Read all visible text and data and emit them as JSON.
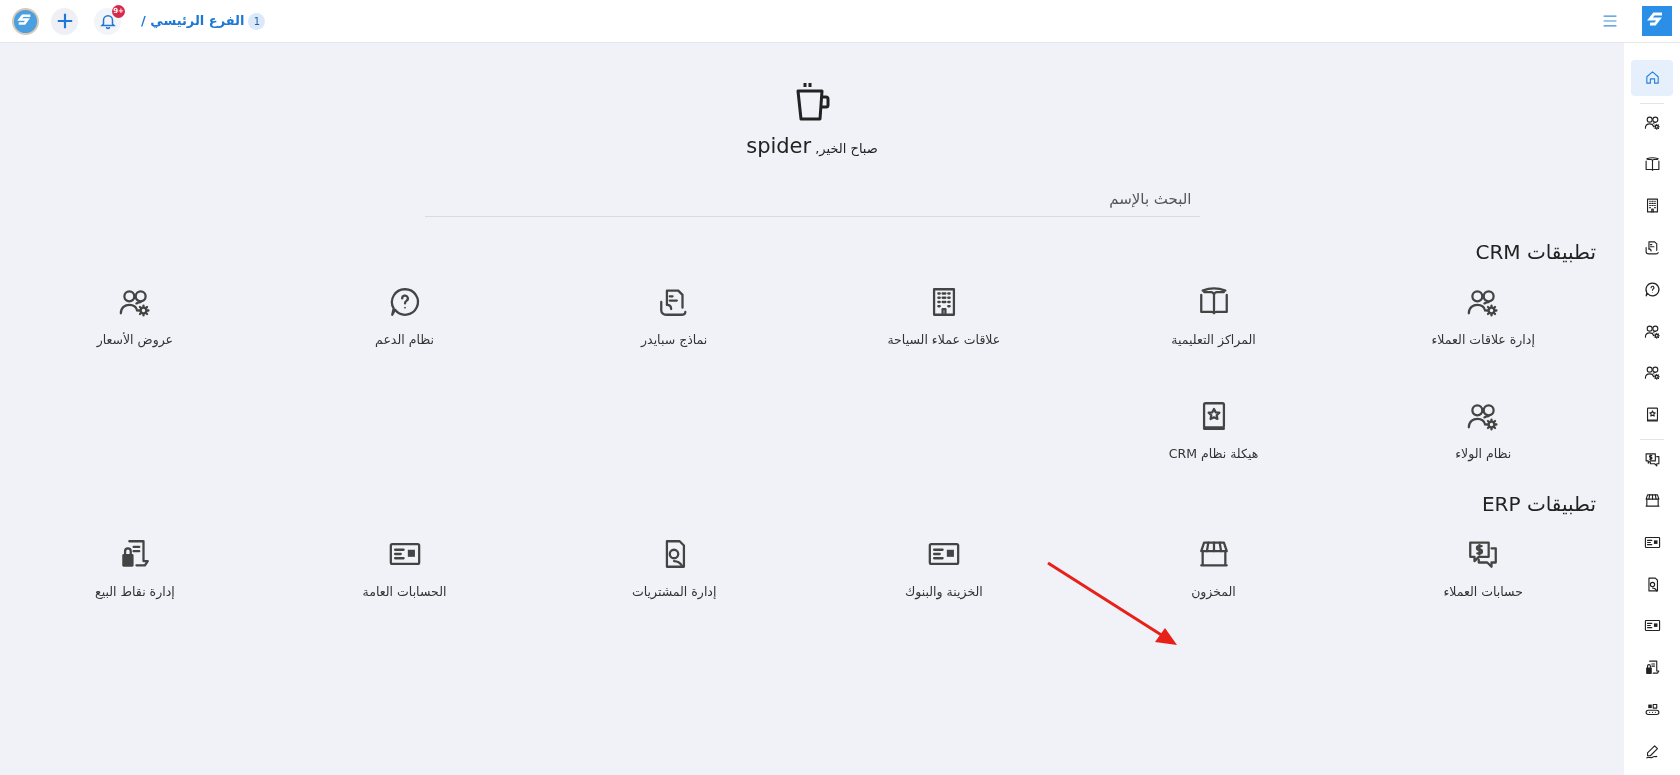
{
  "top_bar": {
    "notifications_badge": "9+",
    "branch_number": "1",
    "branch": "الفرع الرئيسي /"
  },
  "greeting": {
    "text": "صباح الخير,",
    "user": "spider"
  },
  "search": {
    "placeholder": "البحث بالإسم"
  },
  "sections": [
    {
      "title": "تطبيقات CRM",
      "apps": [
        {
          "label": "إدارة علاقات العملاء"
        },
        {
          "label": "المراكز التعليمية"
        },
        {
          "label": "علاقات عملاء السياحة"
        },
        {
          "label": "نماذج سبايدر"
        },
        {
          "label": "نظام الدعم"
        },
        {
          "label": "عروض الأسعار"
        },
        {
          "label": "نظام الولاء"
        },
        {
          "label": "هيكلة نظام CRM"
        }
      ]
    },
    {
      "title": "تطبيقات ERP",
      "apps": [
        {
          "label": "حسابات العملاء"
        },
        {
          "label": "المخزون"
        },
        {
          "label": "الخزينة والبنوك"
        },
        {
          "label": "إدارة المشتريات"
        },
        {
          "label": "الحسابات العامة"
        },
        {
          "label": "إدارة نقاط البيع"
        }
      ]
    }
  ],
  "sidebar": {
    "items": [
      {
        "selected": true
      },
      {
        "selected": false
      },
      {
        "selected": false
      },
      {
        "selected": false
      },
      {
        "selected": false
      },
      {
        "selected": false
      },
      {
        "selected": false
      },
      {
        "selected": false
      },
      {
        "selected": false
      },
      {
        "selected": false
      },
      {
        "selected": false
      },
      {
        "selected": false
      },
      {
        "selected": false
      },
      {
        "selected": false
      },
      {
        "selected": false
      },
      {
        "selected": false
      },
      {
        "selected": false
      }
    ]
  }
}
